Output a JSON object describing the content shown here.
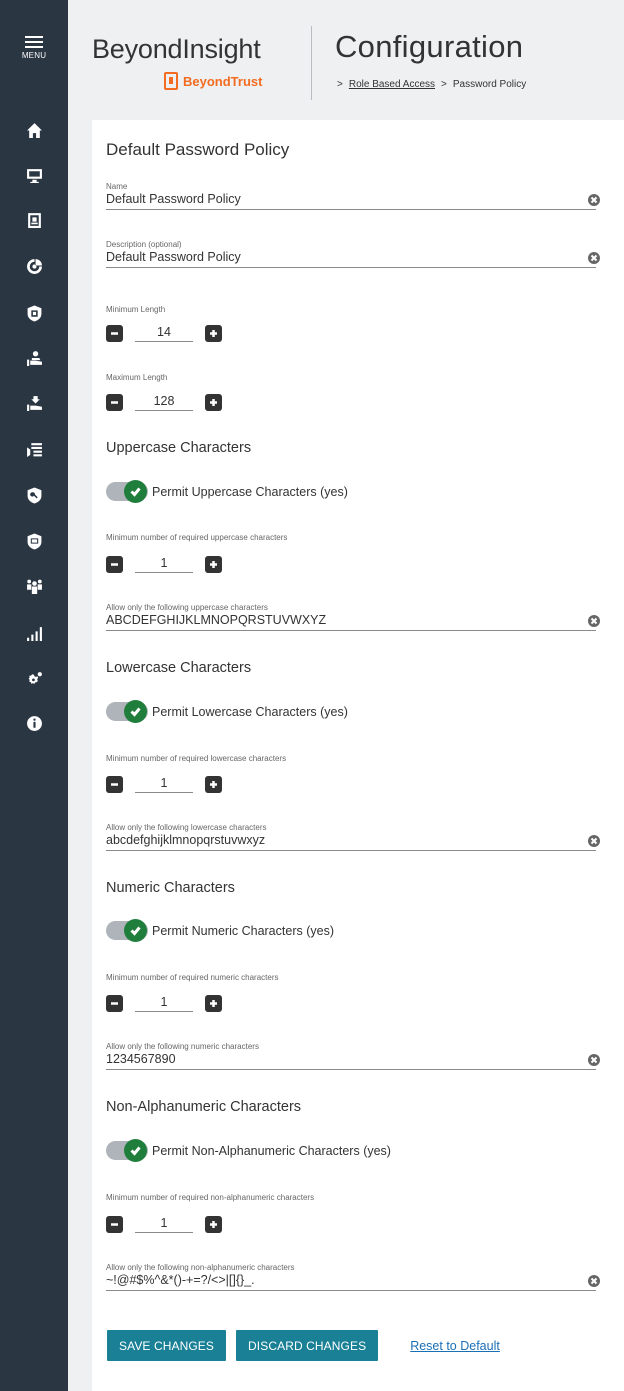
{
  "nav": {
    "menu_label": "MENU",
    "icons": [
      "home-icon",
      "monitor-icon",
      "badge-icon",
      "analytics-icon",
      "vault-icon",
      "hand-user-icon",
      "hand-tray-icon",
      "firewall-icon",
      "shield-key-icon",
      "shield-device-icon",
      "users-icon",
      "reports-icon",
      "settings-icon",
      "info-icon"
    ]
  },
  "header": {
    "brand": "BeyondInsight",
    "subbrand": "BeyondTrust",
    "title": "Configuration",
    "breadcrumb": {
      "sep": ">",
      "link": "Role Based Access",
      "current": "Password Policy"
    }
  },
  "panel": {
    "title": "Default Password Policy",
    "name": {
      "label": "Name",
      "value": "Default Password Policy"
    },
    "description": {
      "label": "Description (optional)",
      "value": "Default Password Policy"
    },
    "min_length": {
      "label": "Minimum Length",
      "value": "14"
    },
    "max_length": {
      "label": "Maximum Length",
      "value": "128"
    },
    "uppercase": {
      "title": "Uppercase Characters",
      "toggle_label": "Permit Uppercase Characters (yes)",
      "toggle_on": true,
      "min_label": "Minimum number of required uppercase characters",
      "min_value": "1",
      "allow_label": "Allow only the following uppercase characters",
      "allow_value": "ABCDEFGHIJKLMNOPQRSTUVWXYZ"
    },
    "lowercase": {
      "title": "Lowercase Characters",
      "toggle_label": "Permit Lowercase Characters (yes)",
      "toggle_on": true,
      "min_label": "Minimum number of required lowercase characters",
      "min_value": "1",
      "allow_label": "Allow only the following lowercase characters",
      "allow_value": "abcdefghijklmnopqrstuvwxyz"
    },
    "numeric": {
      "title": "Numeric Characters",
      "toggle_label": "Permit Numeric Characters (yes)",
      "toggle_on": true,
      "min_label": "Minimum number of required numeric characters",
      "min_value": "1",
      "allow_label": "Allow only the following numeric characters",
      "allow_value": "1234567890"
    },
    "nonalpha": {
      "title": "Non-Alphanumeric Characters",
      "toggle_label": "Permit Non-Alphanumeric Characters (yes)",
      "toggle_on": true,
      "min_label": "Minimum number of required non-alphanumeric characters",
      "min_value": "1",
      "allow_label": "Allow only the following non-alphanumeric characters",
      "allow_value": "~!@#$%^&*()-+=?/<>|[]{}_."
    }
  },
  "actions": {
    "save": "SAVE CHANGES",
    "discard": "DISCARD CHANGES",
    "reset": "Reset to Default"
  },
  "colors": {
    "sidebar": "#2b3643",
    "primary_button": "#1a8096",
    "toggle_on": "#1f7e3b",
    "brand_orange": "#f36c21",
    "link": "#1a6fb5"
  }
}
